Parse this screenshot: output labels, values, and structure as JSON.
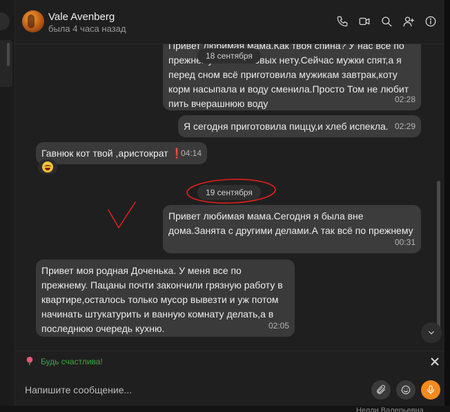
{
  "contact": {
    "name": "Vale Avenberg",
    "status": "была 4 часа назад"
  },
  "header_icons": [
    "phone-icon",
    "video-camera-icon",
    "search-icon",
    "add-user-icon",
    "info-icon"
  ],
  "messages": [
    {
      "side": "right",
      "text": "Привет любимая мама.Как твоя спина? У нас всё по прежнему.Ничего новых нету.Сейчас мужки спят,а я перед сном всё приготовила мужикам завтрак,коту корм насыпала и воду сменила.Просто Том не любит пить вчерашнюю воду",
      "time": "02:28"
    },
    {
      "side": "right",
      "text": "Я сегодня приготовила пиццу,и хлеб испекла.",
      "time": "02:29"
    },
    {
      "side": "left",
      "text": "Гавнюк кот твой ,аристократ ❗",
      "time": "04:14",
      "reaction": "laughing-emoji"
    },
    {
      "side": "right",
      "text": "Привет любимая мама.Сегодня я была вне дома.Занята с другими делами.А так всё по прежнему",
      "time": "00:31"
    },
    {
      "side": "left",
      "text": "Привет моя родная Доченька. У меня все по прежнему. Пацаны почти закончили грязную работу в квартире,осталось только мусор вывезти и уж потом начинать штукатурить и ванную комнату делать,а в последнюю очередь кухню.",
      "time": "02:05"
    }
  ],
  "date_separators": [
    "18 сентября",
    "19 сентября"
  ],
  "reply_preview": {
    "text": "Будь счастлива!",
    "accent": "#3ea84a"
  },
  "composer": {
    "placeholder": "Напишите сообщение..."
  },
  "peek_text": "Нелли Валерьевна",
  "colors": {
    "accent": "#f58a1e",
    "annotation": "#e0201a",
    "bubble": "#3a3a3a",
    "background": "#1f1f1f"
  }
}
